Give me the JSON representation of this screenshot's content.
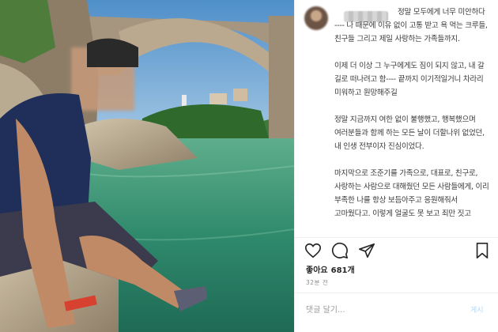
{
  "post": {
    "paragraphs": [
      "정말 모두에게 너무 미안하다 ---- 나 때문에 이유 없이 고통 받고 욕 먹는 크루들, 친구들 그리고 제일 사랑하는 가족들까지.",
      "이제 더 이상 그 누구에게도 짐이 되지 않고, 내 갈 길로 떠나려고 함---- 끝까지 이기적일거니 차라리 미워하고 원망해주길",
      "정말 지금까지 여한 없이 불행했고, 행복했으며 여러분들과 함께 하는 모든 날이 더할나위 없었던, 내 인생 전부이자 진심이었다.",
      "마지막으로 조준기를 가족으로, 대표로, 친구로, 사랑하는 사람으로 대해줬던 모든 사람들에게, 이리 부족한 나를 항상 보듬아주고 응원해줘서 고마웠다고. 이렇게 얼굴도 못 보고 죄만 짓고"
    ]
  },
  "actions": {
    "like_icon": "heart-icon",
    "comment_icon": "comment-icon",
    "share_icon": "send-icon",
    "save_icon": "bookmark-icon"
  },
  "likes": {
    "label": "좋아요",
    "count": "681개"
  },
  "timestamp": "32분 전",
  "comment": {
    "placeholder": "댓글 달기...",
    "post_label": "게시"
  },
  "colors": {
    "sky": "#7fb0d8",
    "water": "#2f8a6c",
    "stone": "#b3a58e",
    "post_button": "#b6d6f5"
  }
}
